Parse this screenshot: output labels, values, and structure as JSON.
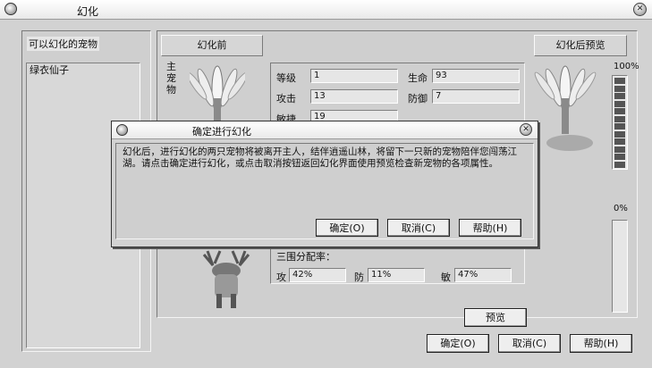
{
  "window": {
    "title": "幻化"
  },
  "left_panel": {
    "header": "可以幻化的宠物",
    "pets": [
      "绿衣仙子"
    ]
  },
  "before": {
    "header": "幻化前",
    "main_pet_label": "主宠物",
    "stats": {
      "level_label": "等级",
      "level": "1",
      "life_label": "生命",
      "life": "93",
      "attack_label": "攻击",
      "attack": "13",
      "defense_label": "防御",
      "defense": "7",
      "agility_label": "敏捷",
      "agility": "19"
    },
    "distribution_label": "三围分配率：",
    "dist": {
      "attack_label": "攻",
      "attack": "42%",
      "defense_label": "防",
      "defense": "11%",
      "agility_label": "敏",
      "agility": "47%"
    }
  },
  "after": {
    "header": "幻化后预览",
    "meter_top": "100%",
    "meter_bottom": "0%",
    "meter_level": 1.0
  },
  "buttons": {
    "preview": "预览",
    "confirm": "确定(O)",
    "cancel": "取消(C)",
    "help": "帮助(H)"
  },
  "dialog": {
    "title": "确定进行幻化",
    "message": "幻化后，进行幻化的两只宠物将被离开主人，结伴逍遥山林，将留下一只新的宠物陪伴您闯荡江湖。请点击确定进行幻化，或点击取消按钮返回幻化界面使用预览检查新宠物的各项属性。",
    "confirm": "确定(O)",
    "cancel": "取消(C)",
    "help": "帮助(H)"
  }
}
